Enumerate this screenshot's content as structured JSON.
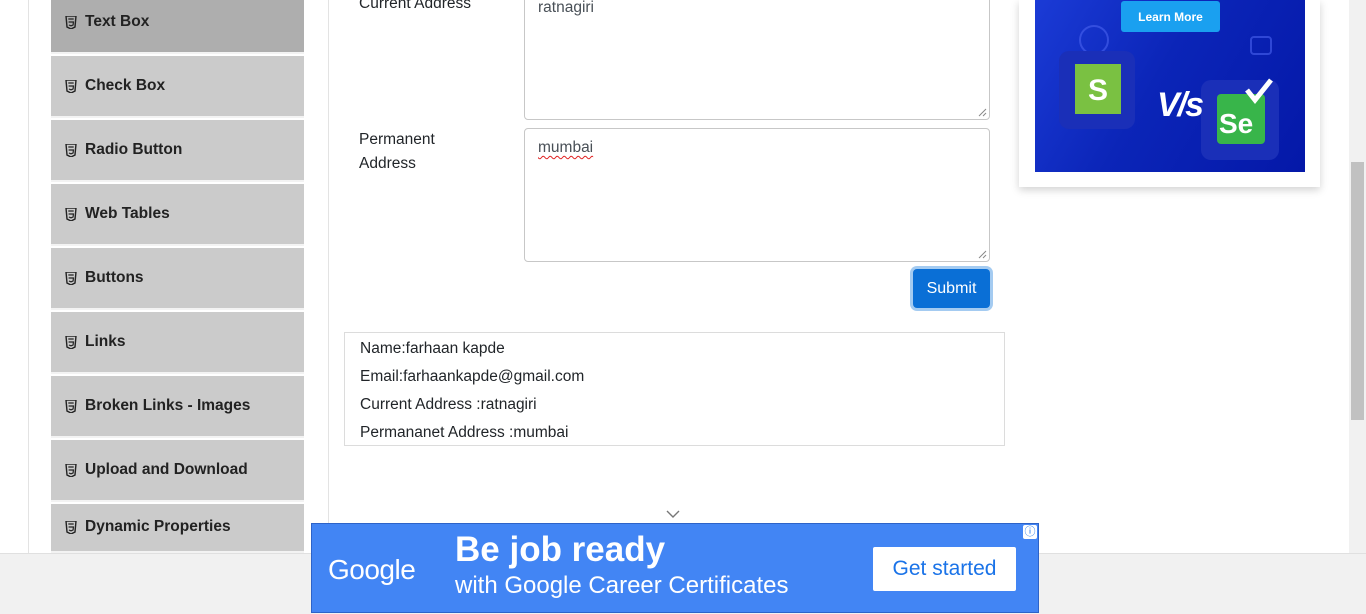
{
  "sidebar": {
    "items": [
      {
        "label": "Text Box",
        "icon": "html5-icon",
        "active": true
      },
      {
        "label": "Check Box",
        "icon": "html5-icon"
      },
      {
        "label": "Radio Button",
        "icon": "html5-icon"
      },
      {
        "label": "Web Tables",
        "icon": "html5-icon"
      },
      {
        "label": "Buttons",
        "icon": "html5-icon"
      },
      {
        "label": "Links",
        "icon": "html5-icon"
      },
      {
        "label": "Broken Links - Images",
        "icon": "html5-icon"
      },
      {
        "label": "Upload and Download",
        "icon": "html5-icon"
      },
      {
        "label": "Dynamic Properties",
        "icon": "html5-icon"
      }
    ]
  },
  "form": {
    "current_address_label": "Current Address",
    "current_address_value": "ratnagiri",
    "permanent_address_label_line1": "Permanent",
    "permanent_address_label_line2": "Address",
    "permanent_address_value": "mumbai",
    "submit_label": "Submit"
  },
  "output": {
    "name": "Name:farhaan kapde",
    "email": "Email:farhaankapde@gmail.com",
    "current_address": "Current Address :ratnagiri",
    "permanent_address": "Permananet Address :mumbai"
  },
  "side_ad": {
    "button_label": "Learn More",
    "vs_text": "V/s",
    "left_logo_letter": "S",
    "right_logo_text": "Se"
  },
  "banner_ad": {
    "brand": "Google",
    "headline": "Be job ready",
    "subline": "with Google Career Certificates",
    "cta": "Get started",
    "info_icon": "ⓘ"
  },
  "colors": {
    "sidebar_bg": "#cbcbcb",
    "sidebar_active_bg": "#aeaeae",
    "submit_bg": "#0a6fd6",
    "banner_bg": "#4285f4",
    "cta_text": "#1a73e8"
  }
}
